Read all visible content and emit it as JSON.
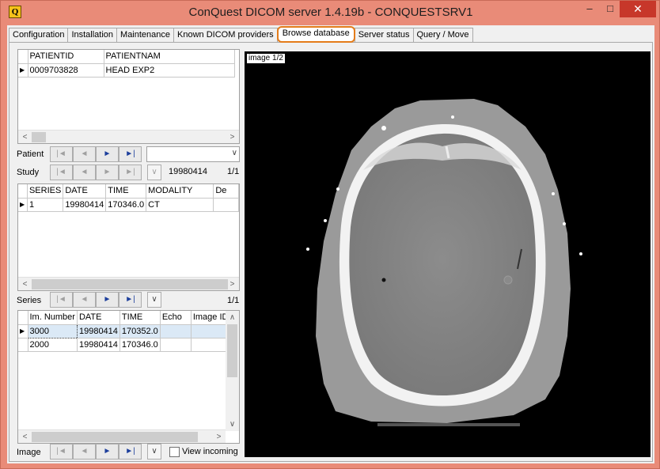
{
  "window": {
    "title": "ConQuest DICOM server 1.4.19b - CONQUESTSRV1",
    "icon": "Q",
    "minimize": "–",
    "maximize": "□",
    "close": "✕"
  },
  "tabs": [
    {
      "label": "Configuration"
    },
    {
      "label": "Installation"
    },
    {
      "label": "Maintenance"
    },
    {
      "label": "Known DICOM providers"
    },
    {
      "label": "Browse database"
    },
    {
      "label": "Server status"
    },
    {
      "label": "Query / Move"
    }
  ],
  "patient_grid": {
    "columns": [
      "PATIENTID",
      "PATIENTNAM"
    ],
    "rows": [
      {
        "id": "0009703828",
        "name": "HEAD EXP2"
      }
    ]
  },
  "patient_nav": {
    "label": "Patient",
    "combo_value": ""
  },
  "study_nav": {
    "label": "Study",
    "date": "19980414",
    "count": "1/1"
  },
  "series_grid": {
    "columns": [
      "SERIES",
      "DATE",
      "TIME",
      "MODALITY",
      "De"
    ],
    "rows": [
      {
        "series": "1",
        "date": "19980414",
        "time": "170346.0",
        "modality": "CT",
        "desc": ""
      }
    ]
  },
  "series_nav": {
    "label": "Series",
    "count": "1/1"
  },
  "image_grid": {
    "columns": [
      "Im. Number",
      "DATE",
      "TIME",
      "Echo",
      "Image ID"
    ],
    "rows": [
      {
        "number": "3000",
        "date": "19980414",
        "time": "170352.0",
        "echo": "",
        "image_id": ""
      },
      {
        "number": "2000",
        "date": "19980414",
        "time": "170346.0",
        "echo": "",
        "image_id": ""
      }
    ]
  },
  "image_nav": {
    "label": "Image",
    "view_incoming": "View incoming",
    "view_incoming_checked": false
  },
  "viewer": {
    "label": "image 1/2"
  },
  "nav_glyphs": {
    "first": "|◄",
    "prev": "◄",
    "next": "►",
    "last": "►|",
    "dropdown": "∨",
    "combo_arrow": "∨",
    "left": "<",
    "right": ">",
    "up": "∧",
    "down": "∨",
    "row_pointer": "▶"
  }
}
